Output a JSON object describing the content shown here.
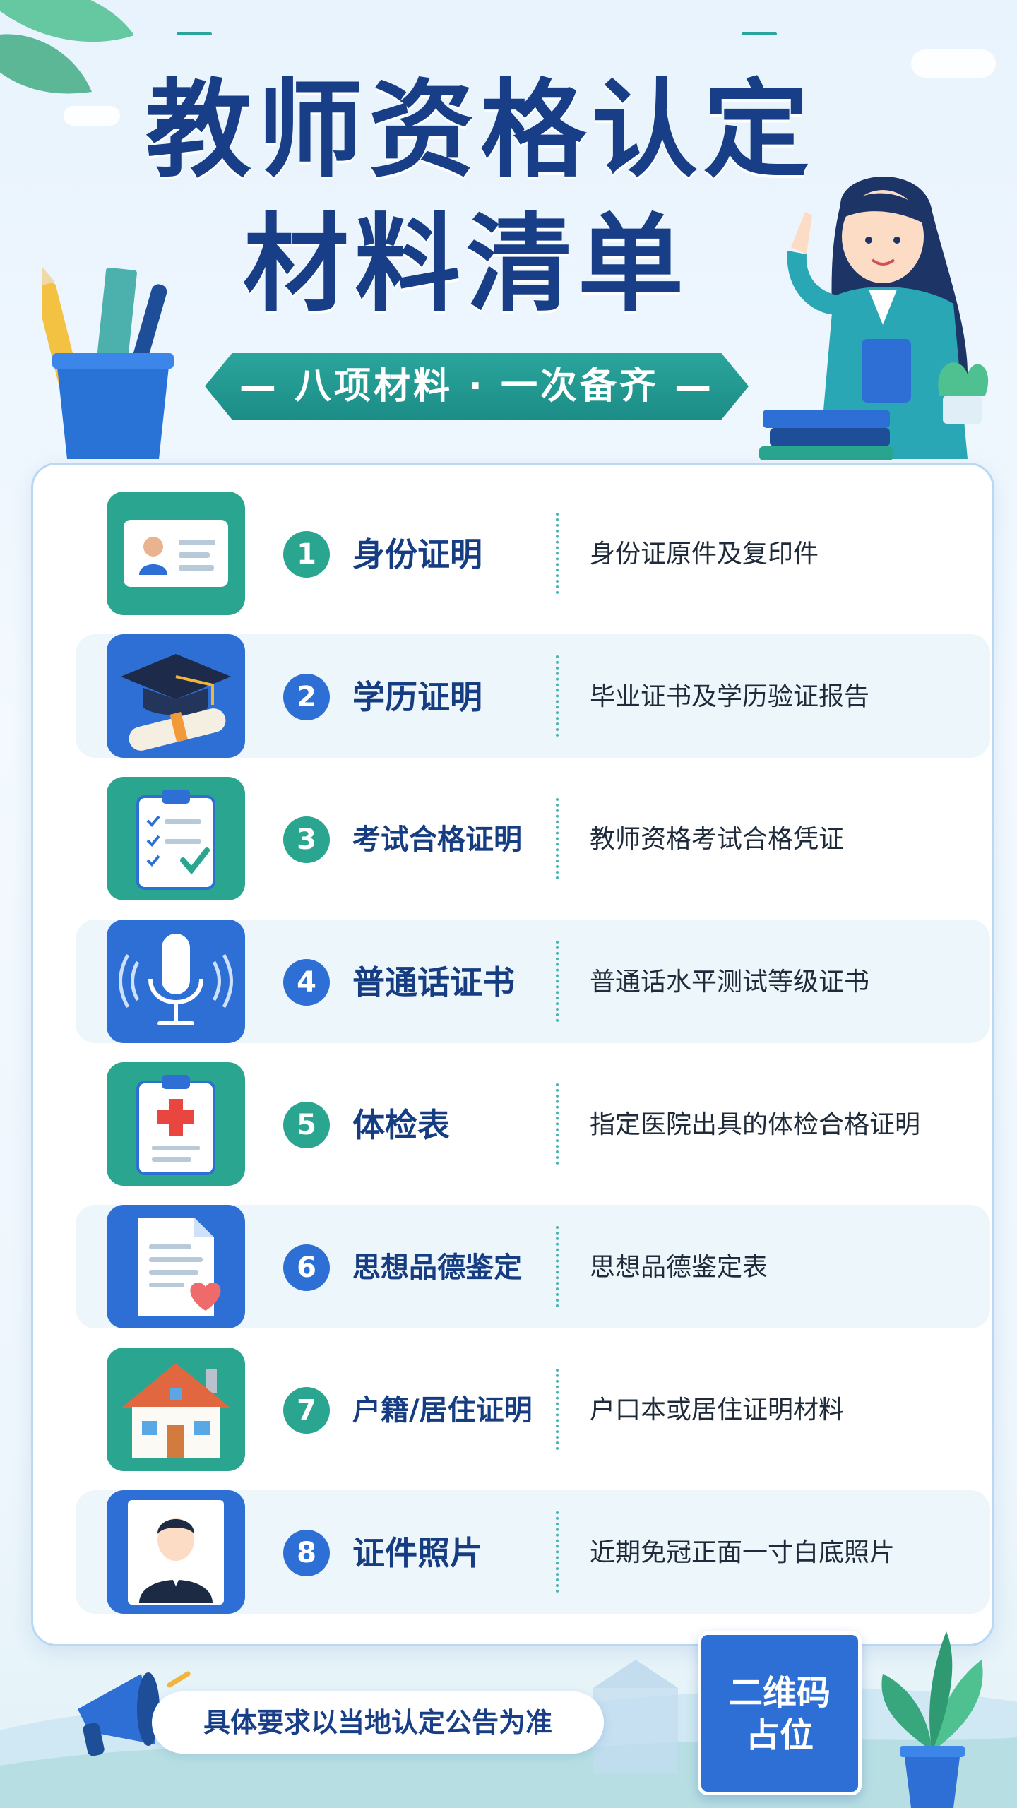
{
  "title": {
    "line1": "教师资格认定",
    "line2": "材料清单"
  },
  "subtitle": "— 八项材料 · 一次备齐 —",
  "materials": [
    {
      "num": "1",
      "name": "身份证明",
      "desc": "身份证原件及复印件",
      "icon": "id-card-icon"
    },
    {
      "num": "2",
      "name": "学历证明",
      "desc": "毕业证书及学历验证报告",
      "icon": "graduation-cap-icon"
    },
    {
      "num": "3",
      "name": "考试合格证明",
      "desc": "教师资格考试合格凭证",
      "icon": "clipboard-check-icon"
    },
    {
      "num": "4",
      "name": "普通话证书",
      "desc": "普通话水平测试等级证书",
      "icon": "microphone-icon"
    },
    {
      "num": "5",
      "name": "体检表",
      "desc": "指定医院出具的体检合格证明",
      "icon": "medical-clipboard-icon"
    },
    {
      "num": "6",
      "name": "思想品德鉴定",
      "desc": "思想品德鉴定表",
      "icon": "document-heart-icon"
    },
    {
      "num": "7",
      "name": "户籍/居住证明",
      "desc": "户口本或居住证明材料",
      "icon": "house-icon"
    },
    {
      "num": "8",
      "name": "证件照片",
      "desc": "近期免冠正面一寸白底照片",
      "icon": "portrait-photo-icon"
    }
  ],
  "footer": {
    "notice": "具体要求以当地认定公告为准",
    "qr_line1": "二维码",
    "qr_line2": "占位"
  },
  "colors": {
    "navy": "#173e86",
    "teal": "#2aa58f",
    "blue": "#2e6fd6"
  }
}
